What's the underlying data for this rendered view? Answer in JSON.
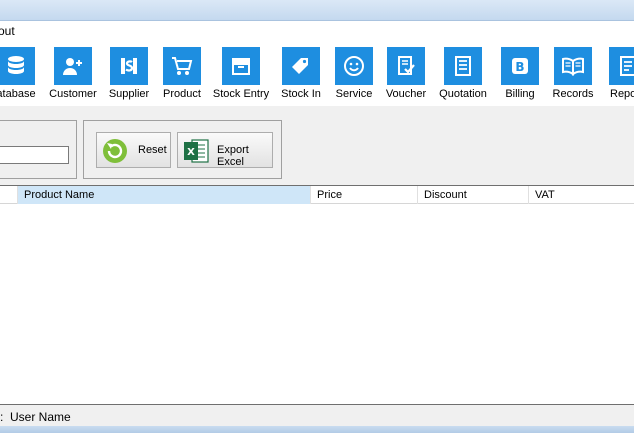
{
  "menu": {
    "item": "out"
  },
  "toolbar": {
    "items": [
      {
        "label": "atabase",
        "icon": "database-icon"
      },
      {
        "label": "Customer",
        "icon": "customer-icon"
      },
      {
        "label": "Supplier",
        "icon": "supplier-icon"
      },
      {
        "label": "Product",
        "icon": "cart-icon"
      },
      {
        "label": "Stock Entry",
        "icon": "stock-entry-icon"
      },
      {
        "label": "Stock In",
        "icon": "tag-icon"
      },
      {
        "label": "Service",
        "icon": "smiley-icon"
      },
      {
        "label": "Voucher",
        "icon": "voucher-icon"
      },
      {
        "label": "Quotation",
        "icon": "quotation-icon"
      },
      {
        "label": "Billing",
        "icon": "billing-icon"
      },
      {
        "label": "Records",
        "icon": "book-icon"
      },
      {
        "label": "Repor",
        "icon": "report-icon"
      }
    ]
  },
  "search": {
    "value": ""
  },
  "actions": {
    "reset_label": "Reset",
    "export_label": "Export Excel"
  },
  "grid": {
    "columns": [
      "Product Name",
      "Price",
      "Discount",
      "VAT"
    ]
  },
  "status": {
    "prefix": ":",
    "user_label": "User Name"
  },
  "colors": {
    "tile": "#1e8ee0",
    "selected_column": "#cfe6f8"
  }
}
